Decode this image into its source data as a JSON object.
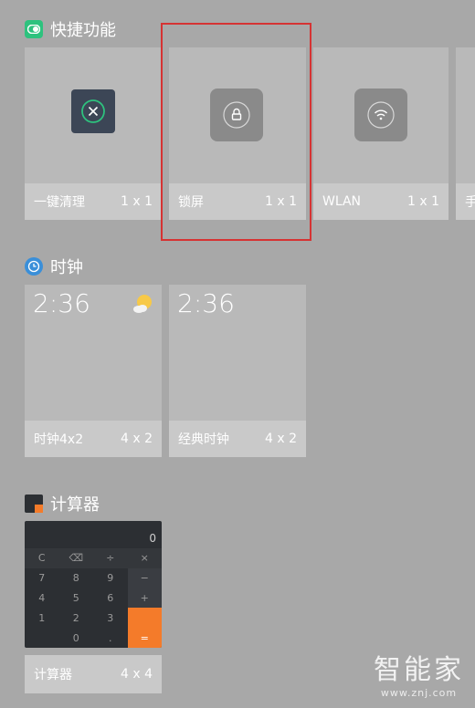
{
  "sections": {
    "quick": {
      "title": "快捷功能",
      "cards": [
        {
          "label": "一键清理",
          "size": "1 x 1",
          "icon": "close-circle-icon"
        },
        {
          "label": "锁屏",
          "size": "1 x 1",
          "icon": "lock-icon"
        },
        {
          "label": "WLAN",
          "size": "1 x 1",
          "icon": "wifi-icon"
        },
        {
          "label": "手",
          "size": "",
          "icon": ""
        }
      ]
    },
    "clock": {
      "title": "时钟",
      "cards": [
        {
          "time": "2:36",
          "label": "时钟4x2",
          "size": "4 x 2",
          "icon": "weather-sun-cloud-icon"
        },
        {
          "time": "2:36",
          "label": "经典时钟",
          "size": "4 x 2"
        }
      ]
    },
    "calculator": {
      "title": "计算器",
      "display": "0",
      "keys": [
        [
          "C",
          "⌫",
          "÷",
          "×"
        ],
        [
          "7",
          "8",
          "9",
          "−"
        ],
        [
          "4",
          "5",
          "6",
          "+"
        ],
        [
          "1",
          "2",
          "3",
          ""
        ],
        [
          "",
          "0",
          ".",
          "="
        ]
      ],
      "card": {
        "label": "计算器",
        "size": "4 x 4"
      }
    }
  },
  "watermark": {
    "main": "智能家",
    "sub": "www.znj.com"
  },
  "colors": {
    "background": "#a8a8a8",
    "highlight": "#d63333",
    "calc_equals": "#f47b2a",
    "quick_icon": "#2ec27e",
    "clock_icon": "#3a8fd9"
  }
}
